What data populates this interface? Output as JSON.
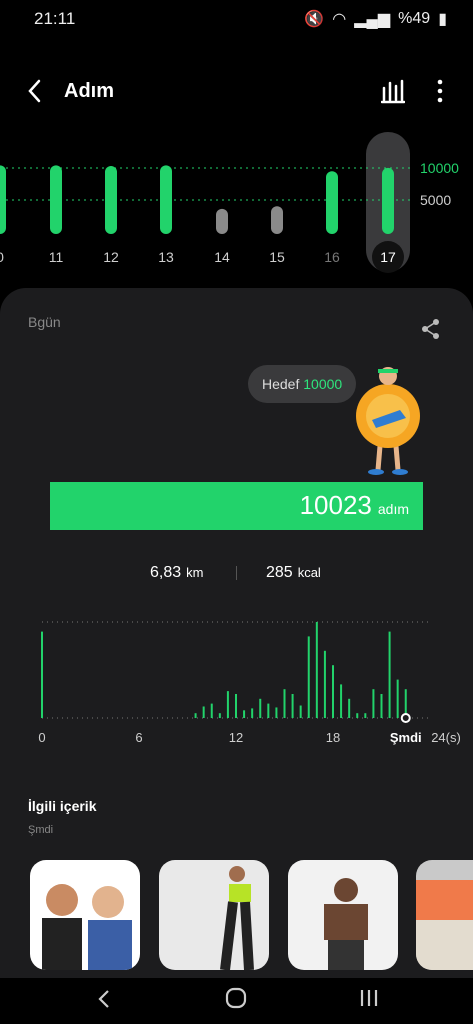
{
  "status": {
    "time": "21:11",
    "battery": "%49"
  },
  "header": {
    "title": "Adım"
  },
  "week": {
    "days": [
      "0",
      "11",
      "12",
      "13",
      "14",
      "15",
      "16",
      "17"
    ],
    "goal_label": "10000",
    "mid_label": "5000",
    "steps": [
      10400,
      10500,
      10300,
      10400,
      3800,
      4200,
      9500,
      10023
    ],
    "selected": "17"
  },
  "today": {
    "label": "Bgün",
    "goal_text": "Hedef",
    "goal_value": "10000",
    "steps": "10023",
    "steps_unit": "adım",
    "progress": 1.0,
    "distance": "6,83",
    "distance_unit": "km",
    "calories": "285",
    "calories_unit": "kcal"
  },
  "chart_data": {
    "type": "bar",
    "x": [
      0,
      9.5,
      10,
      10.5,
      11,
      11.5,
      12,
      12.5,
      13,
      13.5,
      14,
      14.5,
      15,
      15.5,
      16,
      16.5,
      17,
      17.5,
      18,
      18.5,
      19,
      19.5,
      20,
      20.5,
      21,
      21.5,
      22,
      22.5
    ],
    "values": [
      900,
      50,
      120,
      150,
      50,
      280,
      250,
      80,
      100,
      200,
      150,
      110,
      300,
      250,
      130,
      850,
      1000,
      700,
      550,
      350,
      200,
      50,
      50,
      300,
      250,
      900,
      400,
      300
    ],
    "xticks": [
      "0",
      "6",
      "12",
      "18",
      "Şmdi",
      "24(s)"
    ],
    "current_hour": 22.5,
    "color": "#22d36b"
  },
  "related": {
    "title": "İlgili içerik",
    "subtitle": "Şmdi"
  }
}
